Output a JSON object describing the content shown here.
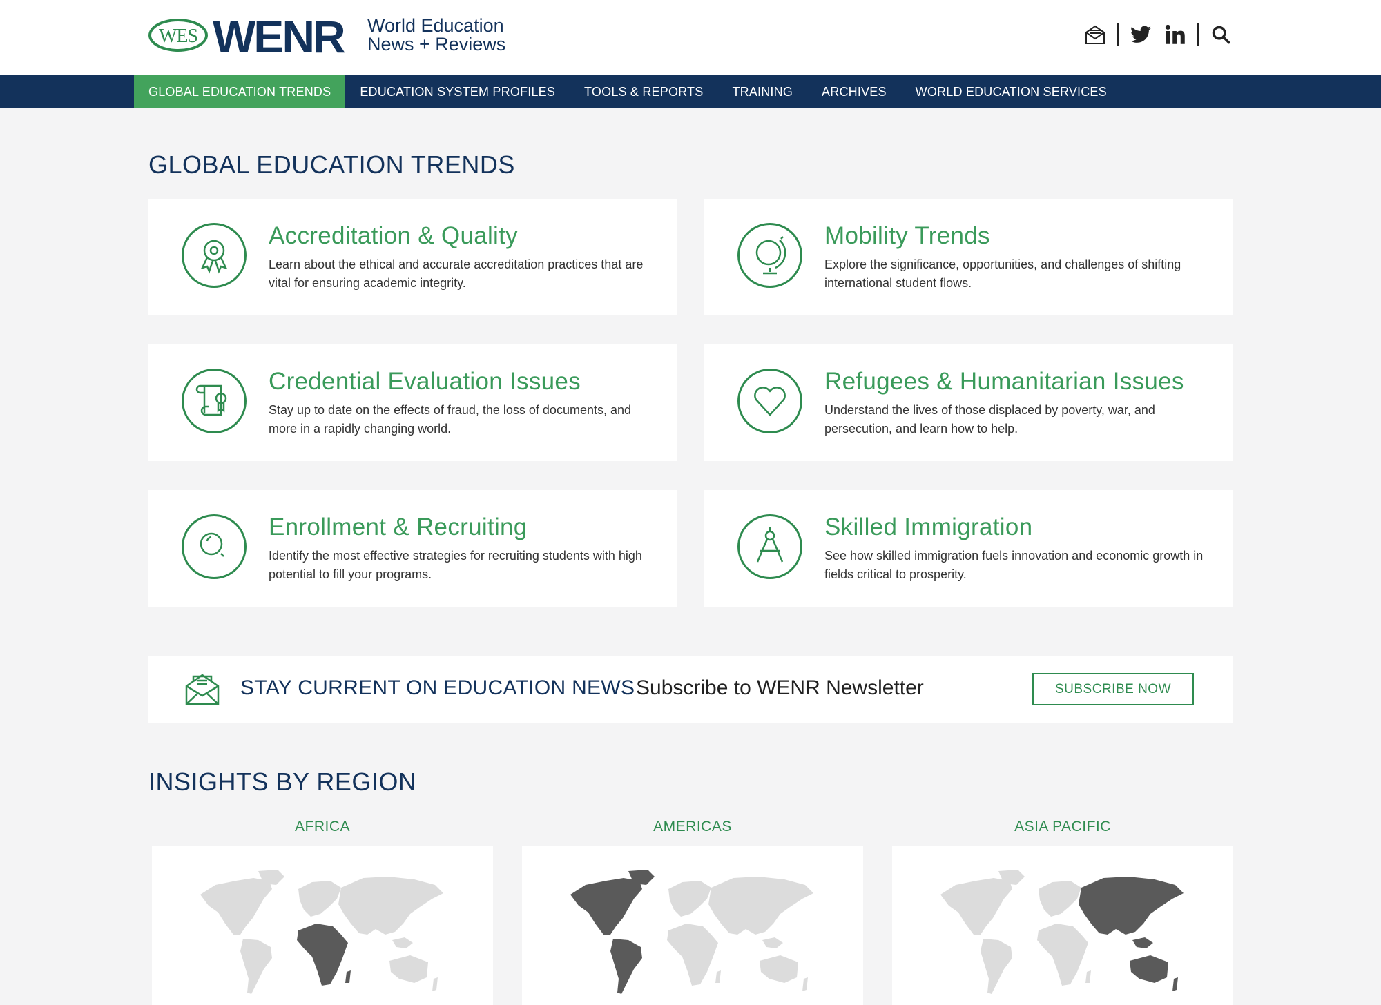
{
  "header": {
    "logo_wes": "WES",
    "logo_wenr": "WENR",
    "logo_line1": "World Education",
    "logo_line2": "News + Reviews",
    "icons": [
      "newsletter-icon",
      "twitter-icon",
      "linkedin-icon",
      "search-icon"
    ]
  },
  "nav": {
    "items": [
      {
        "label": "GLOBAL EDUCATION TRENDS",
        "active": true
      },
      {
        "label": "EDUCATION SYSTEM PROFILES"
      },
      {
        "label": "TOOLS & REPORTS"
      },
      {
        "label": "TRAINING"
      },
      {
        "label": "ARCHIVES"
      },
      {
        "label": "WORLD EDUCATION SERVICES"
      }
    ]
  },
  "trends": {
    "title": "GLOBAL EDUCATION TRENDS",
    "cards": [
      {
        "title": "Accreditation & Quality",
        "desc": "Learn about the ethical and accurate accreditation practices that are vital for ensuring academic integrity.",
        "icon": "award-ribbon-icon"
      },
      {
        "title": "Mobility Trends",
        "desc": "Explore the significance, opportunities, and challenges of shifting international student flows.",
        "icon": "globe-icon"
      },
      {
        "title": "Credential Evaluation Issues",
        "desc": "Stay up to date on the effects of fraud, the loss of documents, and more in a rapidly changing world.",
        "icon": "diploma-icon"
      },
      {
        "title": "Refugees & Humanitarian Issues",
        "desc": "Understand the lives of those displaced by poverty, war, and persecution, and learn how to help.",
        "icon": "heart-icon"
      },
      {
        "title": "Enrollment & Recruiting",
        "desc": "Identify the most effective strategies for recruiting students with high potential to fill your programs.",
        "icon": "magnifier-icon"
      },
      {
        "title": "Skilled Immigration",
        "desc": "See how skilled immigration fuels innovation and economic growth in fields critical to prosperity.",
        "icon": "compass-icon"
      }
    ]
  },
  "newsletter": {
    "heading": "STAY CURRENT ON EDUCATION NEWS",
    "subheading": "Subscribe to WENR Newsletter",
    "button": "SUBSCRIBE NOW"
  },
  "regions": {
    "title": "INSIGHTS BY REGION",
    "items": [
      {
        "label": "AFRICA",
        "highlight": "africa"
      },
      {
        "label": "AMERICAS",
        "highlight": "americas"
      },
      {
        "label": "ASIA PACIFIC",
        "highlight": "asia"
      }
    ]
  },
  "colors": {
    "navy": "#13325b",
    "green": "#43a35c",
    "map_grey": "#dcdcdc",
    "map_highlight": "#5a5a5a"
  }
}
